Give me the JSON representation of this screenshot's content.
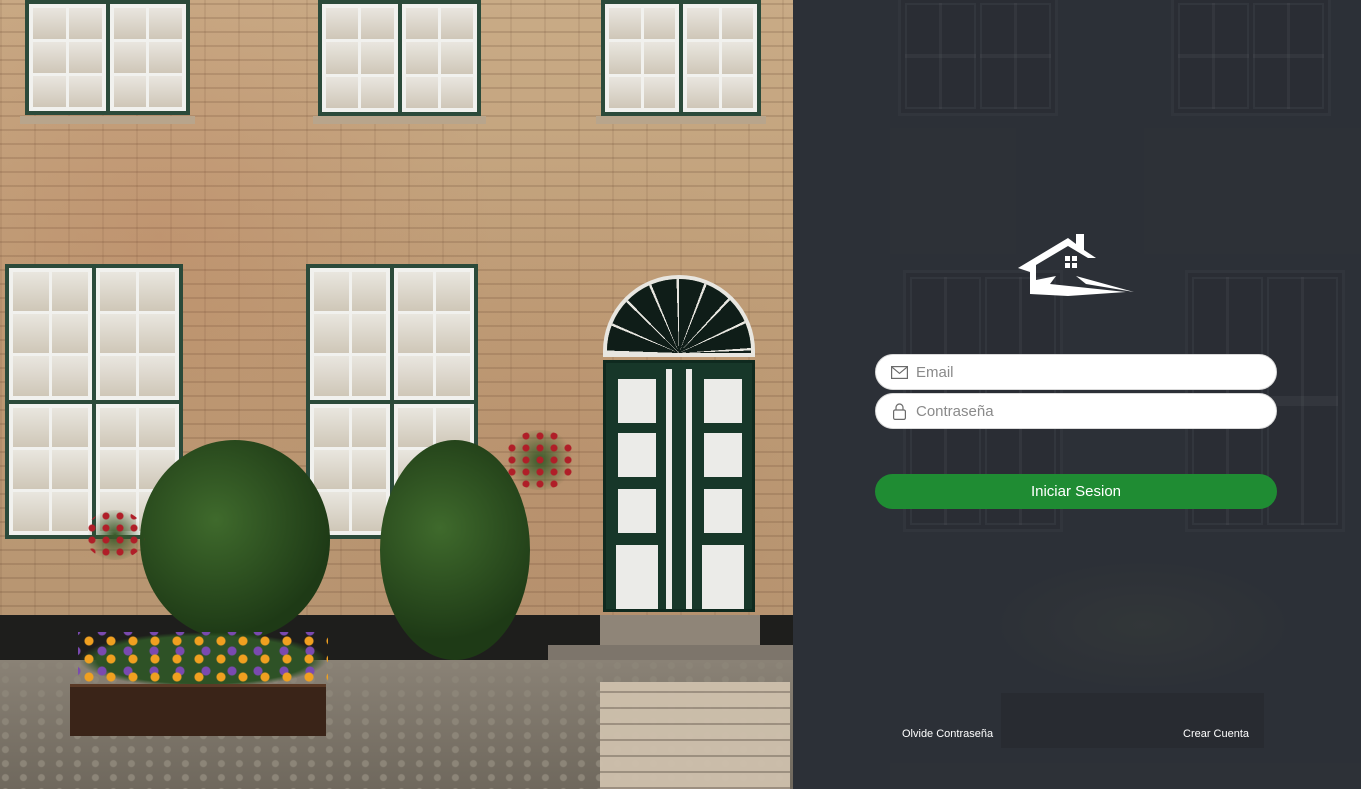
{
  "login": {
    "email_placeholder": "Email",
    "password_placeholder": "Contraseña",
    "submit_label": "Iniciar Sesion",
    "forgot_password_label": "Olvide Contraseña",
    "create_account_label": "Crear Cuenta"
  },
  "icons": {
    "logo": "house-logo-icon",
    "email": "envelope-icon",
    "password": "lock-icon"
  },
  "colors": {
    "accent_button": "#1f8c33",
    "panel_background": "#2e3238",
    "field_background": "#ffffff"
  }
}
